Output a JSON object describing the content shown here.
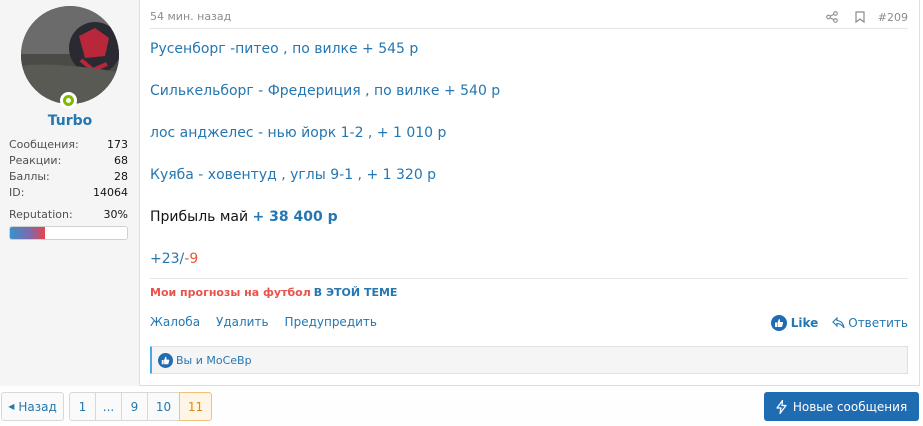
{
  "user": {
    "name": "Turbo",
    "stats": [
      {
        "label": "Сообщения:",
        "value": "173"
      },
      {
        "label": "Реакции:",
        "value": "68"
      },
      {
        "label": "Баллы:",
        "value": "28"
      },
      {
        "label": "ID:",
        "value": "14064"
      }
    ],
    "reputation_label": "Reputation:",
    "reputation_value": "30%",
    "reputation_fraction": 0.3
  },
  "post": {
    "time": "54 мин. назад",
    "number": "#209",
    "lines": [
      "Русенборг -питео , по вилке + 545 р",
      "Силькельборг - Фредериция , по вилке + 540 р",
      "лос анджелес - нью йорк 1-2 , + 1 010 р",
      "Куяба - ховентуд , углы 9-1 , + 1 320 р"
    ],
    "profit_label": "Прибыль май",
    "profit_value": "+ 38 400 р",
    "score_plus": "+23",
    "score_sep": "/",
    "score_minus": "-9",
    "signature_red": "Мои прогнозы на футбол",
    "signature_blue": "В ЭТОЙ ТЕМЕ",
    "actions": {
      "report": "Жалоба",
      "delete": "Удалить",
      "warn": "Предупредить",
      "like": "Like",
      "reply": "Ответить"
    },
    "reactions_text": "Вы и MoCeBp"
  },
  "pager": {
    "prev": "Назад",
    "pages": [
      "1",
      "...",
      "9",
      "10",
      "11"
    ],
    "current": "11"
  },
  "new_messages": "Новые сообщения",
  "colors": {
    "accent": "#2577b1",
    "button": "#1f6cb3",
    "online": "#7fb900",
    "signature_red": "#e8534b"
  }
}
